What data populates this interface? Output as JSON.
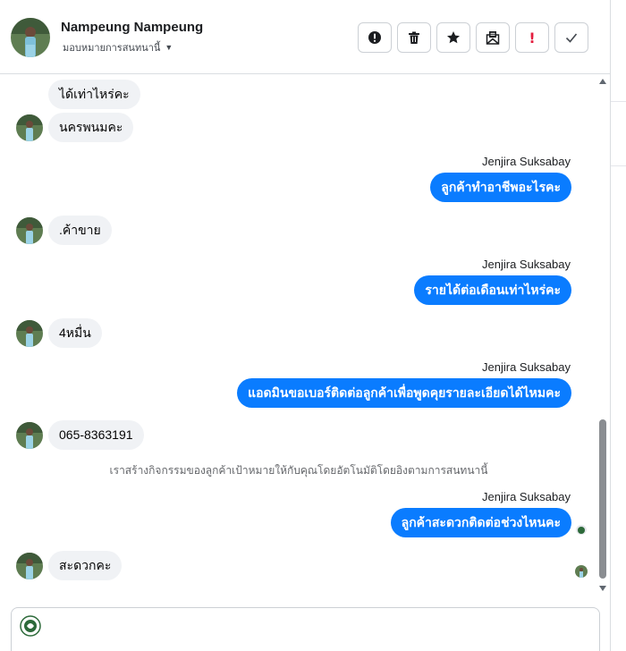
{
  "header": {
    "contact_name": "Nampeung Nampeung",
    "assign_label": "มอบหมายการสนทนานี้",
    "actions": [
      {
        "name": "report-spam-button",
        "icon": "exclamation-circle-icon"
      },
      {
        "name": "delete-button",
        "icon": "trash-icon"
      },
      {
        "name": "star-button",
        "icon": "star-icon"
      },
      {
        "name": "mark-unread-button",
        "icon": "envelope-icon"
      },
      {
        "name": "follow-up-button",
        "icon": "red-exclamation-icon",
        "text": "!"
      },
      {
        "name": "mark-done-button",
        "icon": "checkmark-icon"
      }
    ]
  },
  "colors": {
    "outgoing_bubble": "#0a7cff",
    "incoming_bubble": "#f0f2f5",
    "follow_up_red": "#e41e3f"
  },
  "thread": {
    "agent_name": "Jenjira Suksabay",
    "messages": [
      {
        "from": "customer",
        "text": "ได้เท่าไหร่คะ"
      },
      {
        "from": "customer",
        "text": "นครพนมคะ"
      },
      {
        "from": "agent",
        "text": "ลูกค้าทำอาชีพอะไรคะ"
      },
      {
        "from": "customer",
        "text": ".ค้าขาย"
      },
      {
        "from": "agent",
        "text": "รายได้ต่อเดือนเท่าไหร่คะ"
      },
      {
        "from": "customer",
        "text": "4หมื่น"
      },
      {
        "from": "agent",
        "text": "แอดมินขอเบอร์ติดต่อลูกค้าเพื่อพูดคุยรายละเอียดได้ไหมคะ"
      },
      {
        "from": "customer",
        "text": "065-8363191"
      },
      {
        "from": "system",
        "text": "เราสร้างกิจกรรมของลูกค้าเป้าหมายให้กับคุณโดยอัตโนมัติโดยอิงตามการสนทนานี้"
      },
      {
        "from": "agent",
        "text": "ลูกค้าสะดวกติดต่อช่วงไหนคะ"
      },
      {
        "from": "customer",
        "text": "สะดวกคะ"
      }
    ]
  },
  "composer": {
    "value": "",
    "placeholder": ""
  }
}
